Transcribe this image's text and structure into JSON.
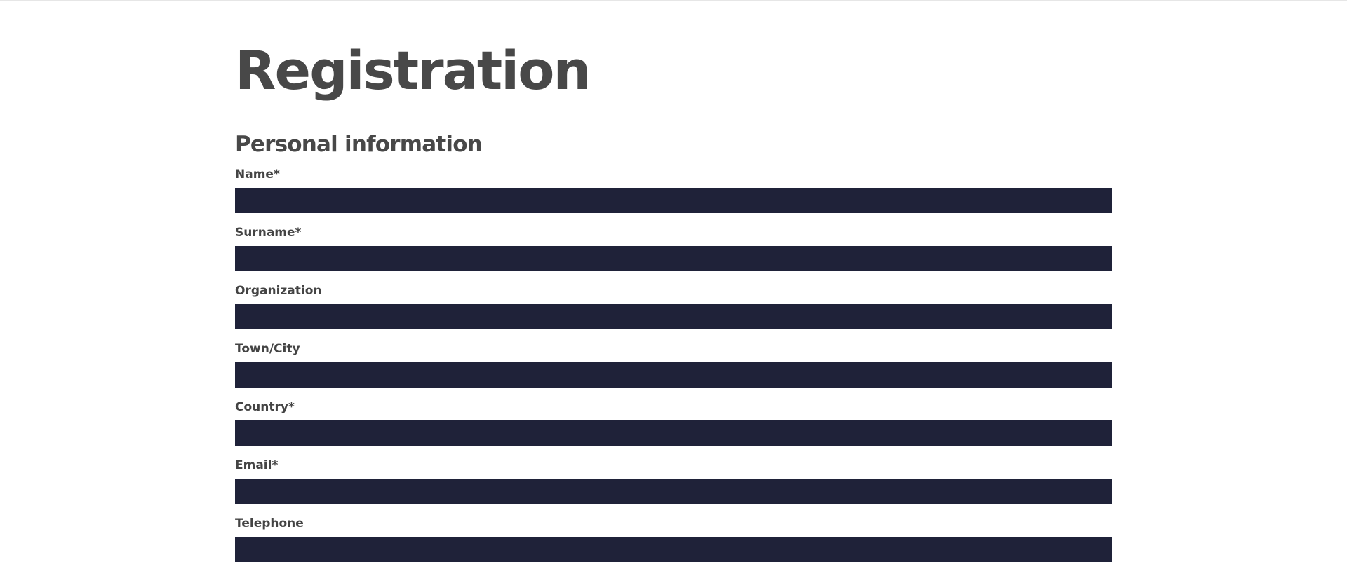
{
  "page": {
    "title": "Registration"
  },
  "form": {
    "section_title": "Personal information",
    "fields": [
      {
        "label": "Name*",
        "value": "",
        "required": true
      },
      {
        "label": "Surname*",
        "value": "",
        "required": true
      },
      {
        "label": "Organization",
        "value": "",
        "required": false
      },
      {
        "label": "Town/City",
        "value": "",
        "required": false
      },
      {
        "label": "Country*",
        "value": "",
        "required": true
      },
      {
        "label": "Email*",
        "value": "",
        "required": true
      },
      {
        "label": "Telephone",
        "value": "",
        "required": false
      }
    ]
  },
  "colors": {
    "background": "#ffffff",
    "heading_text": "#484848",
    "input_fill": "#1f2239"
  }
}
